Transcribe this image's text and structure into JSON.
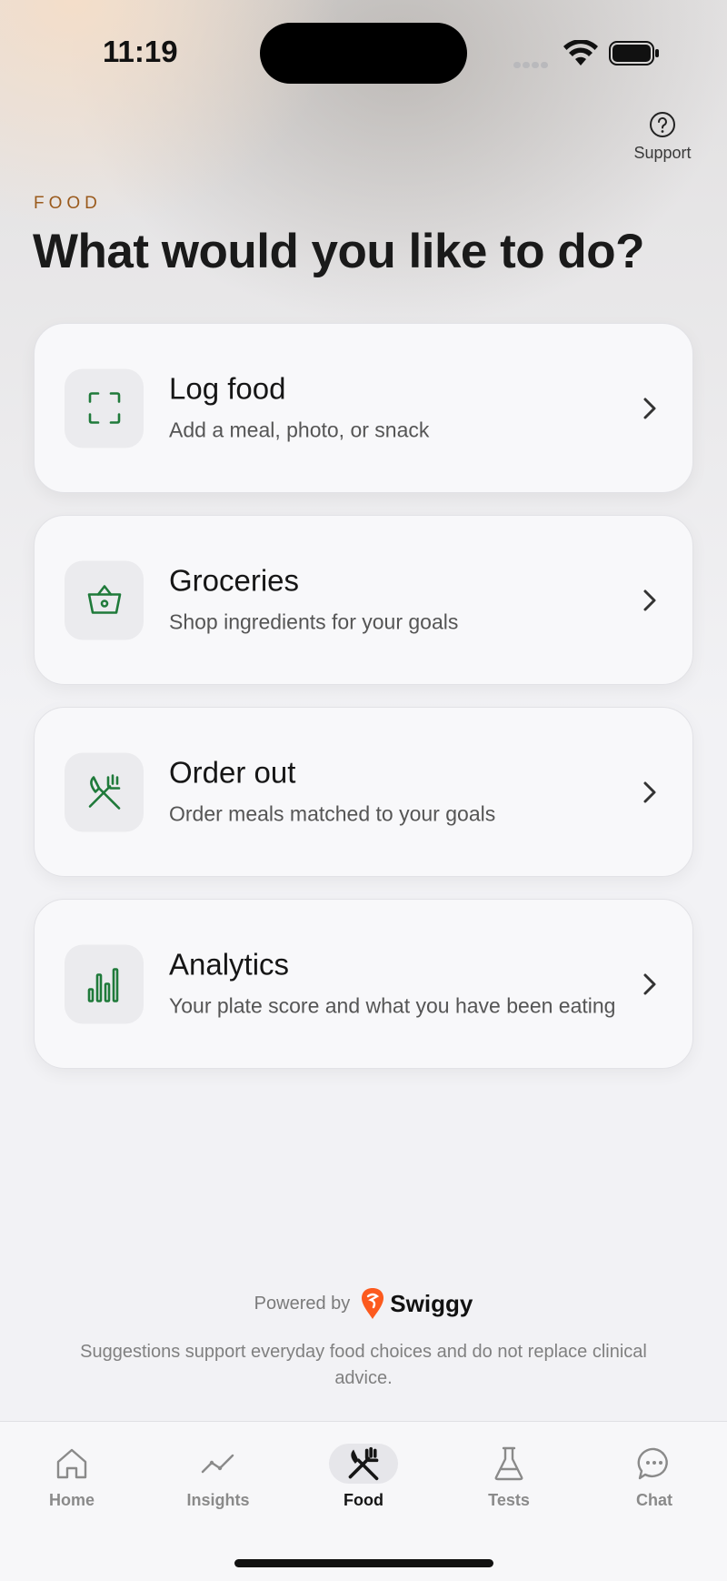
{
  "status": {
    "time": "11:19"
  },
  "header": {
    "support_label": "Support",
    "eyebrow": "FOOD",
    "title": "What would you like to do?"
  },
  "cards": [
    {
      "title": "Log food",
      "subtitle": "Add a meal, photo, or snack",
      "icon": "scan-frame-icon"
    },
    {
      "title": "Groceries",
      "subtitle": "Shop ingredients for your goals",
      "icon": "basket-icon"
    },
    {
      "title": "Order out",
      "subtitle": "Order meals matched to your goals",
      "icon": "fork-knife-icon"
    },
    {
      "title": "Analytics",
      "subtitle": "Your plate score and what you have been eating",
      "icon": "bar-chart-icon"
    }
  ],
  "footer": {
    "powered_by": "Powered by",
    "brand": "Swiggy",
    "disclaimer": "Suggestions support everyday food choices and do not replace clinical advice."
  },
  "tabs": [
    {
      "label": "Home",
      "icon": "home-icon",
      "active": false
    },
    {
      "label": "Insights",
      "icon": "trend-line-icon",
      "active": false
    },
    {
      "label": "Food",
      "icon": "fork-knife-icon",
      "active": true
    },
    {
      "label": "Tests",
      "icon": "flask-icon",
      "active": false
    },
    {
      "label": "Chat",
      "icon": "chat-bubble-icon",
      "active": false
    }
  ],
  "colors": {
    "accent_green": "#1f7a3a",
    "eyebrow_brown": "#9a5a1c",
    "swiggy_orange": "#fc5a1e"
  }
}
